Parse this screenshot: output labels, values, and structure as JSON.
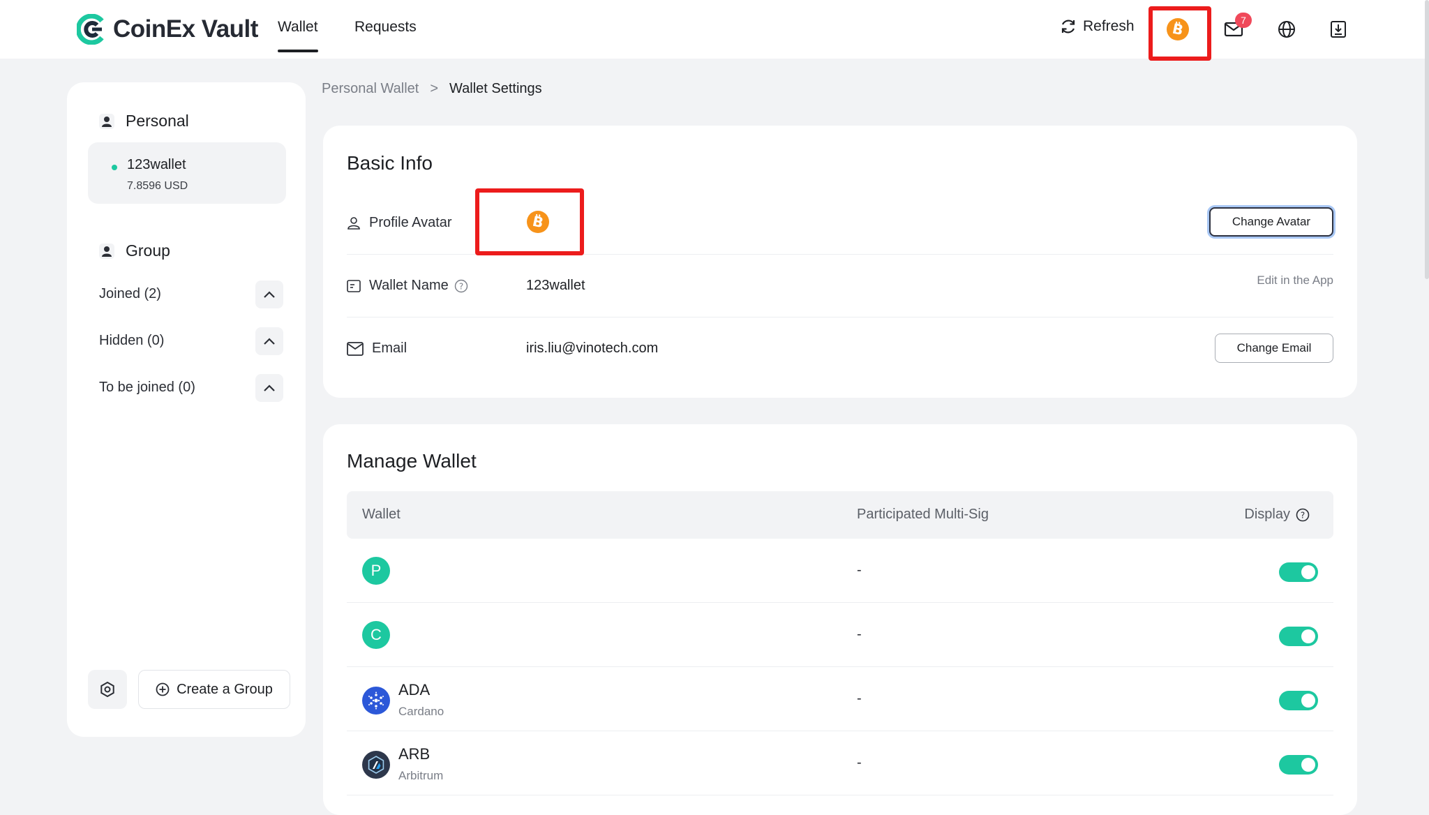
{
  "app": {
    "name": "CoinEx Vault"
  },
  "nav": {
    "tabs": [
      {
        "label": "Wallet"
      },
      {
        "label": "Requests"
      }
    ]
  },
  "header": {
    "refresh_label": "Refresh",
    "mail_count": "7"
  },
  "sidebar": {
    "personal_title": "Personal",
    "wallet": {
      "name": "123wallet",
      "balance": "7.8596  USD"
    },
    "group_title": "Group",
    "groups": [
      {
        "label": "Joined (2)"
      },
      {
        "label": "Hidden (0)"
      },
      {
        "label": "To be joined (0)"
      }
    ],
    "create_group_label": "Create a Group"
  },
  "breadcrumb": {
    "parent": "Personal Wallet",
    "separator": ">",
    "current": "Wallet Settings"
  },
  "basic_info": {
    "title": "Basic Info",
    "avatar_label": "Profile Avatar",
    "change_avatar_label": "Change Avatar",
    "wallet_name_label": "Wallet Name",
    "wallet_name_value": "123wallet",
    "edit_in_app_label": "Edit in the App",
    "email_label": "Email",
    "email_value": "iris.liu@vinotech.com",
    "change_email_label": "Change Email"
  },
  "manage_wallet": {
    "title": "Manage Wallet",
    "columns": [
      "Wallet",
      "Participated Multi-Sig",
      "Display"
    ],
    "rows": [
      {
        "icon": "P",
        "symbol": "",
        "network": "",
        "multisig": "-",
        "display": true
      },
      {
        "icon": "C",
        "symbol": "",
        "network": "",
        "multisig": "-",
        "display": true
      },
      {
        "icon": "cardano-icon",
        "symbol": "ADA",
        "network": "Cardano",
        "multisig": "-",
        "display": true
      },
      {
        "icon": "arbitrum-icon",
        "symbol": "ARB",
        "network": "Arbitrum",
        "multisig": "-",
        "display": true
      }
    ]
  },
  "colors": {
    "accent": "#1dc8a0",
    "bitcoin": "#f7931a",
    "highlight": "#ec1c1c",
    "badge": "#f0495a"
  }
}
